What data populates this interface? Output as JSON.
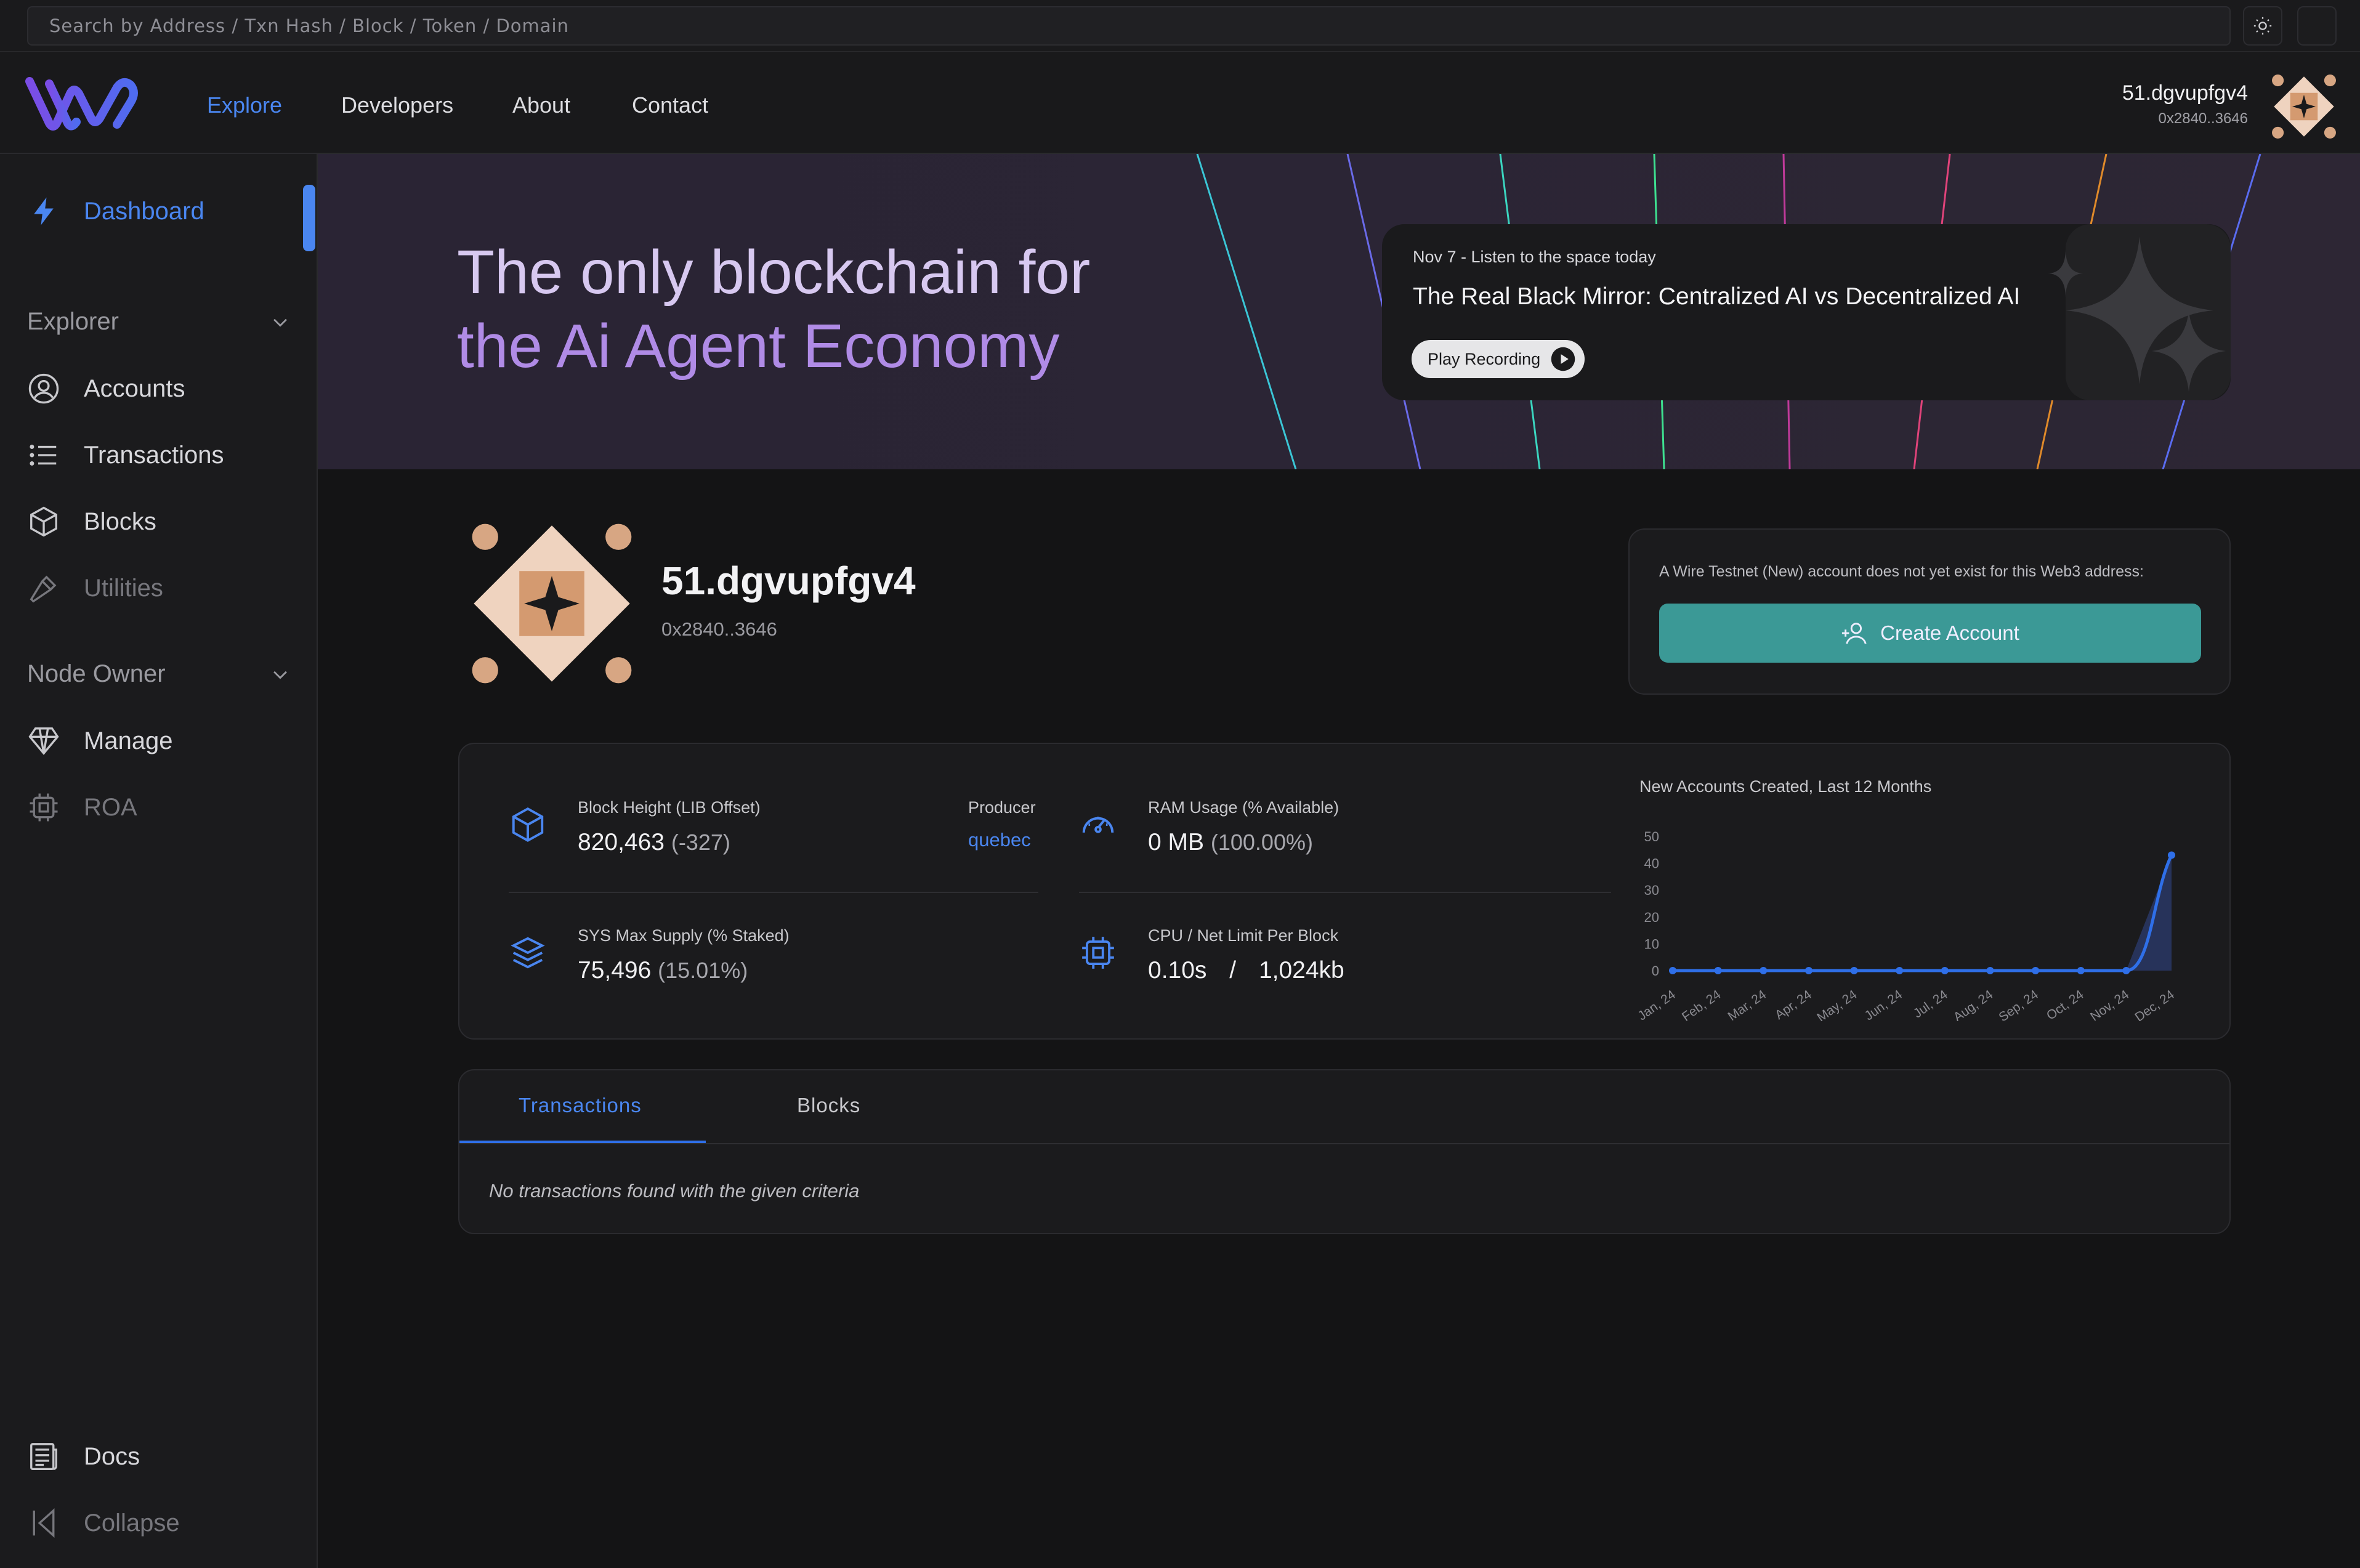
{
  "search": {
    "placeholder": "Search by Address / Txn Hash / Block / Token / Domain"
  },
  "header": {
    "nav": [
      "Explore",
      "Developers",
      "About",
      "Contact"
    ],
    "user_name": "51.dgvupfgv4",
    "user_addr": "0x2840..3646"
  },
  "sidebar": {
    "dashboard": "Dashboard",
    "explorer_section": "Explorer",
    "explorer_items": [
      "Accounts",
      "Transactions",
      "Blocks",
      "Utilities"
    ],
    "node_section": "Node Owner",
    "node_items": [
      "Manage",
      "ROA"
    ],
    "docs": "Docs",
    "collapse": "Collapse"
  },
  "hero": {
    "line1": "The only blockchain for",
    "line2": "the Ai Agent Economy",
    "podcast_date": "Nov 7 - Listen to the space today",
    "podcast_title": "The Real Black Mirror: Centralized AI vs Decentralized AI",
    "podcast_button": "Play Recording"
  },
  "account": {
    "name": "51.dgvupfgv4",
    "address": "0x2840..3646",
    "notice": "A Wire Testnet (New) account does not yet exist for this Web3 address:",
    "create_button": "Create Account"
  },
  "stats": {
    "block_height_label": "Block Height (LIB Offset)",
    "block_height_value": "820,463",
    "block_height_offset": "(-327)",
    "producer_label": "Producer",
    "producer_value": "quebec",
    "ram_label": "RAM Usage (% Available)",
    "ram_value": "0 MB",
    "ram_pct": "(100.00%)",
    "supply_label": "SYS Max Supply (% Staked)",
    "supply_value": "75,496",
    "supply_pct": "(15.01%)",
    "cpu_label": "CPU / Net Limit Per Block",
    "cpu_value": "0.10s",
    "cpu_sep": "/",
    "net_value": "1,024kb"
  },
  "chart_data": {
    "type": "area",
    "title": "New Accounts Created, Last 12 Months",
    "categories": [
      "Jan, 24",
      "Feb, 24",
      "Mar, 24",
      "Apr, 24",
      "May, 24",
      "Jun, 24",
      "Jul, 24",
      "Aug, 24",
      "Sep, 24",
      "Oct, 24",
      "Nov, 24",
      "Dec, 24"
    ],
    "values": [
      0,
      0,
      0,
      0,
      0,
      0,
      0,
      0,
      0,
      0,
      0,
      43
    ],
    "yticks": [
      0,
      10,
      20,
      30,
      40,
      50
    ],
    "ylim": [
      0,
      50
    ],
    "color": "#2f6fe8"
  },
  "tabs": {
    "items": [
      "Transactions",
      "Blocks"
    ],
    "active": "Transactions",
    "empty_message": "No transactions found with the given criteria"
  },
  "colors": {
    "accent": "#4a86f0",
    "teal": "#3b9996",
    "purple": "#b08be6"
  }
}
